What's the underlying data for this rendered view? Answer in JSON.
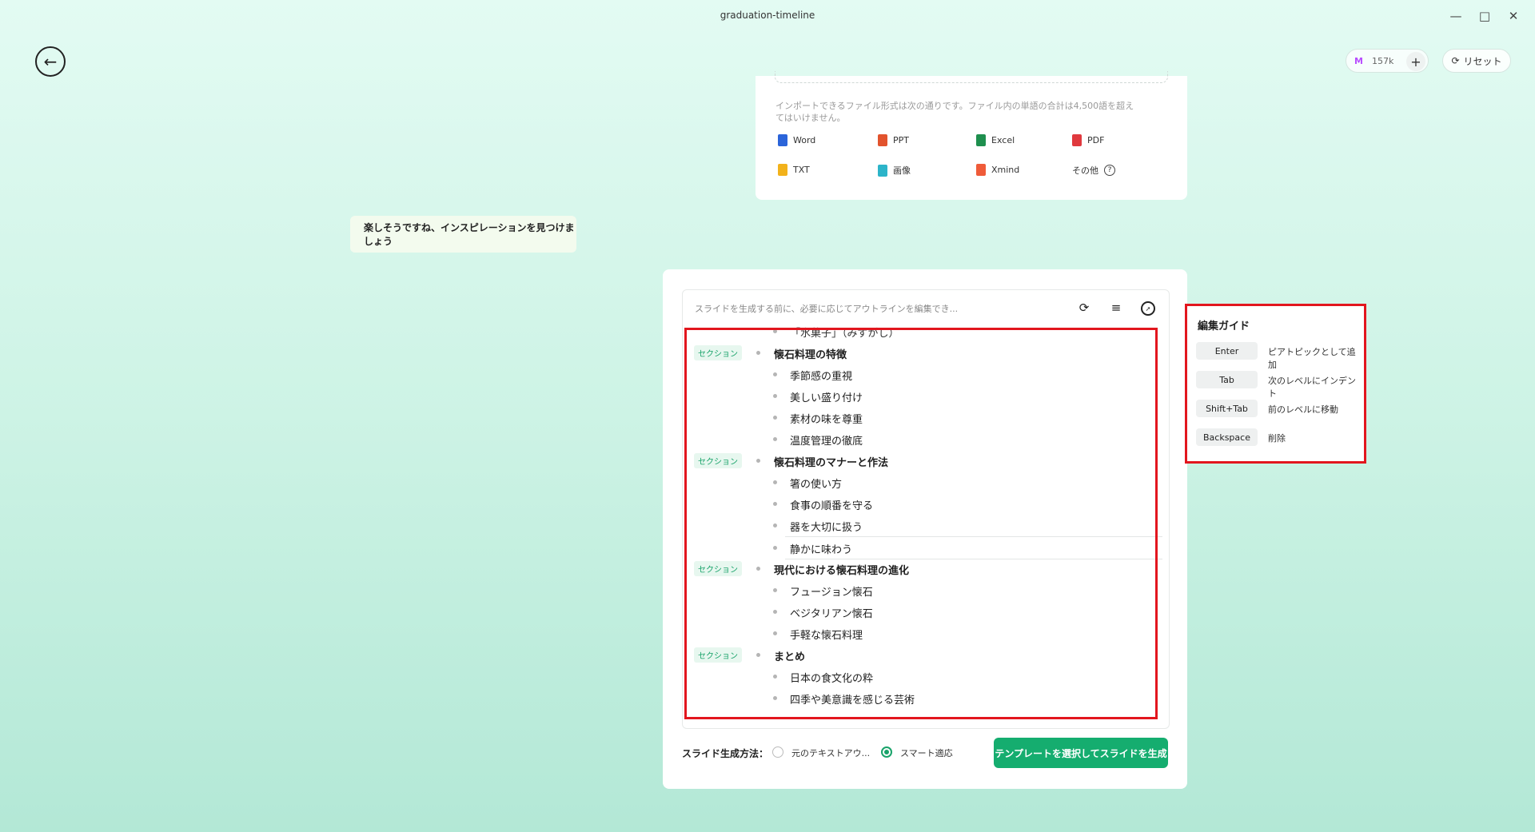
{
  "window": {
    "title": "graduation-timeline",
    "minimize_icon": "minimize-icon",
    "maximize_icon": "maximize-icon",
    "close_icon": "close-icon"
  },
  "header": {
    "credits": "157k",
    "plus": "+",
    "reset_label": "リセット"
  },
  "import": {
    "note": "インポートできるファイル形式は次の通りです。ファイル内の単語の合計は4,500語を超えてはいけません。",
    "file_types": [
      {
        "label": "Word",
        "color": "#2b64d9"
      },
      {
        "label": "PPT",
        "color": "#e2532d"
      },
      {
        "label": "Excel",
        "color": "#1e8f4e"
      },
      {
        "label": "PDF",
        "color": "#e0393e"
      },
      {
        "label": "TXT",
        "color": "#f2b21b"
      },
      {
        "label": "画像",
        "color": "#2cb4c9"
      },
      {
        "label": "Xmind",
        "color": "#ef5b39"
      },
      {
        "label": "その他"
      }
    ]
  },
  "chat": {
    "message": "楽しそうですね、インスピレーションを見つけましょう"
  },
  "outline": {
    "placeholder": "スライドを生成する前に、必要に応じてアウトラインを編集でき...",
    "section_tag": "セクション",
    "partial_item": "「水菓子」（みずがし）",
    "sections": [
      {
        "title": "懐石料理の特徴",
        "items": [
          "季節感の重視",
          "美しい盛り付け",
          "素材の味を尊重",
          "温度管理の徹底"
        ]
      },
      {
        "title": "懐石料理のマナーと作法",
        "items": [
          "箸の使い方",
          "食事の順番を守る",
          "器を大切に扱う",
          "静かに味わう"
        ]
      },
      {
        "title": "現代における懐石料理の進化",
        "items": [
          "フュージョン懐石",
          "ベジタリアン懐石",
          "手軽な懐石料理"
        ]
      },
      {
        "title": "まとめ",
        "items": [
          "日本の食文化の粋",
          "四季や美意識を感じる芸術"
        ]
      }
    ]
  },
  "generation": {
    "label": "スライド生成方法：",
    "option_original": "元のテキストアウ...",
    "option_smart": "スマート適応",
    "selected": "smart",
    "button_label": "テンプレートを選択してスライドを生成"
  },
  "guide": {
    "title": "編集ガイド",
    "rows": [
      {
        "key": "Enter",
        "desc": "ピアトピックとして追加"
      },
      {
        "key": "Tab",
        "desc": "次のレベルにインデント"
      },
      {
        "key": "Shift+Tab",
        "desc": "前のレベルに移動"
      },
      {
        "key": "Backspace",
        "desc": "削除"
      }
    ]
  },
  "colors": {
    "accent": "#15ad6f",
    "highlight": "#e2161e"
  }
}
